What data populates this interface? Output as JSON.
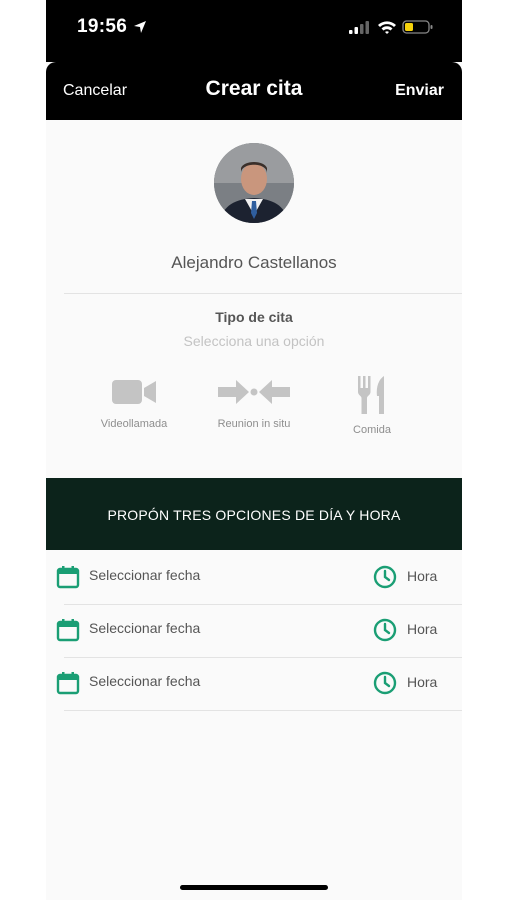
{
  "status_bar": {
    "time": "19:56"
  },
  "nav": {
    "cancel": "Cancelar",
    "title": "Crear cita",
    "send": "Enviar"
  },
  "contact": {
    "name": "Alejandro Castellanos"
  },
  "appointment_type": {
    "label": "Tipo de cita",
    "placeholder": "Selecciona una opción",
    "options": [
      {
        "label": "Videollamada",
        "icon": "video-camera-icon"
      },
      {
        "label": "Reunion in situ",
        "icon": "meeting-arrows-icon"
      },
      {
        "label": "Comida",
        "icon": "fork-knife-icon"
      }
    ]
  },
  "banner": {
    "text": "PROPÓN TRES OPCIONES DE DÍA Y HORA"
  },
  "slots": [
    {
      "date": "Seleccionar fecha",
      "time": "Hora"
    },
    {
      "date": "Seleccionar fecha",
      "time": "Hora"
    },
    {
      "date": "Seleccionar fecha",
      "time": "Hora"
    }
  ],
  "colors": {
    "accent": "#1a9e74",
    "banner_bg": "#0c231b",
    "icon_gray": "#c4c4c4"
  }
}
